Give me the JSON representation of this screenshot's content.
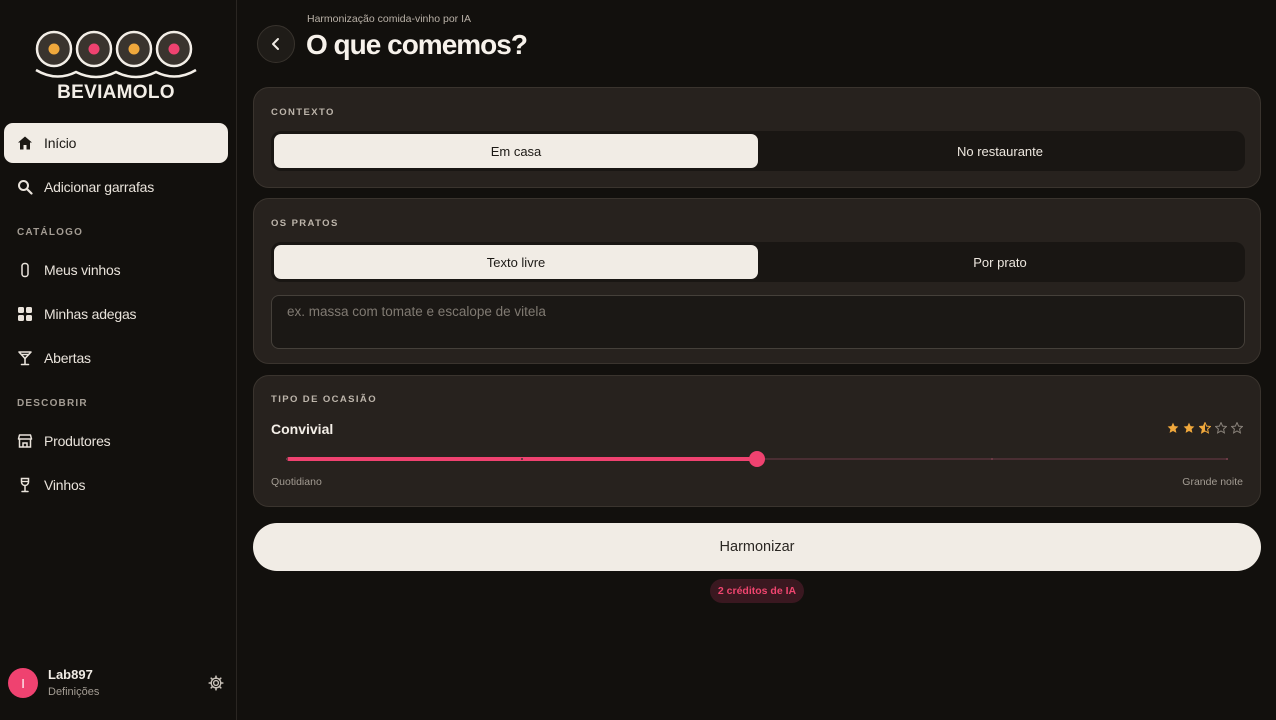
{
  "app": {
    "brand": "BEVIAMOLO",
    "logo_icon": "wine-bottles-logo-icon",
    "colors": {
      "accent": "#ef4270",
      "gold": "#f0a83c",
      "surface": "#27221e",
      "background": "#12100d",
      "light": "#f1ece5"
    }
  },
  "sidebar": {
    "items_top": [
      {
        "label": "Início",
        "icon": "home-icon",
        "active": true
      },
      {
        "label": "Adicionar garrafas",
        "icon": "search-icon",
        "active": false
      }
    ],
    "sections": [
      {
        "label": "CATÁLOGO",
        "items": [
          {
            "label": "Meus vinhos",
            "icon": "bottle-icon"
          },
          {
            "label": "Minhas adegas",
            "icon": "grid-icon"
          },
          {
            "label": "Abertas",
            "icon": "cocktail-glass-icon"
          }
        ]
      },
      {
        "label": "DESCOBRIR",
        "items": [
          {
            "label": "Produtores",
            "icon": "store-icon"
          },
          {
            "label": "Vinhos",
            "icon": "wine-glass-icon"
          }
        ]
      }
    ],
    "user": {
      "initial": "I",
      "name": "Lab897",
      "subtitle": "Definições",
      "settings_icon": "gear-icon"
    }
  },
  "header": {
    "eyebrow": "Harmonização comida-vinho por IA",
    "title": "O que comemos?",
    "back_icon": "chevron-left-icon"
  },
  "context": {
    "label": "CONTEXTO",
    "options": [
      "Em casa",
      "No restaurante"
    ],
    "selected": "Em casa"
  },
  "dishes": {
    "label": "OS PRATOS",
    "options": [
      "Texto livre",
      "Por prato"
    ],
    "selected": "Texto livre",
    "input_value": "",
    "input_placeholder": "ex. massa com tomate e escalope de vitela"
  },
  "occasion": {
    "label": "TIPO DE OCASIÃO",
    "value_label": "Convivial",
    "rating": 2.5,
    "rating_max": 5,
    "slider_level": 0.5,
    "slider_steps": 5,
    "min_label": "Quotidiano",
    "max_label": "Grande noite"
  },
  "submit": {
    "label": "Harmonizar"
  },
  "credits": {
    "text": "2 créditos de IA"
  }
}
